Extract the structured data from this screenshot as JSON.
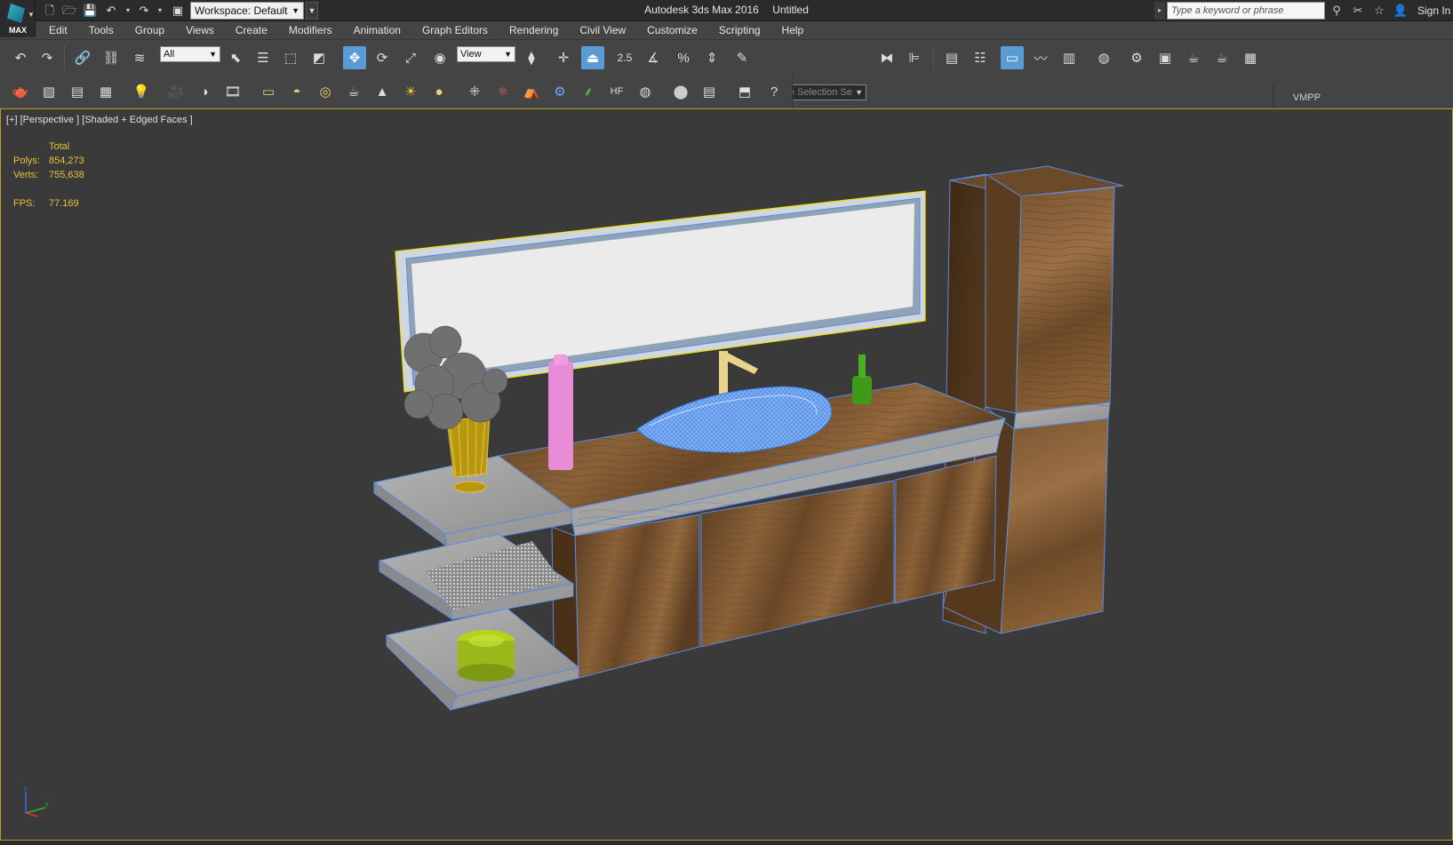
{
  "titlebar": {
    "app_name": "Autodesk 3ds Max 2016",
    "document_name": "Untitled",
    "logo_text": "MAX",
    "workspace_label": "Workspace: Default",
    "search_placeholder": "Type a keyword or phrase",
    "sign_in": "Sign In",
    "icons": [
      "new-file-icon",
      "open-file-icon",
      "save-icon",
      "undo-icon",
      "redo-icon",
      "project-folder-icon",
      "binoculars-icon",
      "subscription-icon",
      "favorites-star-icon",
      "user-icon"
    ]
  },
  "menu": {
    "items": [
      "Edit",
      "Tools",
      "Group",
      "Views",
      "Create",
      "Modifiers",
      "Animation",
      "Graph Editors",
      "Rendering",
      "Civil View",
      "Customize",
      "Scripting",
      "Help"
    ]
  },
  "toolbar": {
    "selection_filter": "All",
    "reference_coord": "View",
    "named_selection_placeholder": "Create Selection Se",
    "snap_label": "2.5",
    "vmpp_label": "VMPP"
  },
  "viewport": {
    "label": "[+] [Perspective ] [Shaded + Edged Faces ]",
    "stats_header": "Total",
    "polys_label": "Polys:",
    "polys_value": "854,273",
    "verts_label": "Verts:",
    "verts_value": "755,638",
    "fps_label": "FPS:",
    "fps_value": "77.169",
    "selection_color": "#f0e000",
    "edge_color": "#5b8be0",
    "wood_color": "#6b4a2a"
  }
}
